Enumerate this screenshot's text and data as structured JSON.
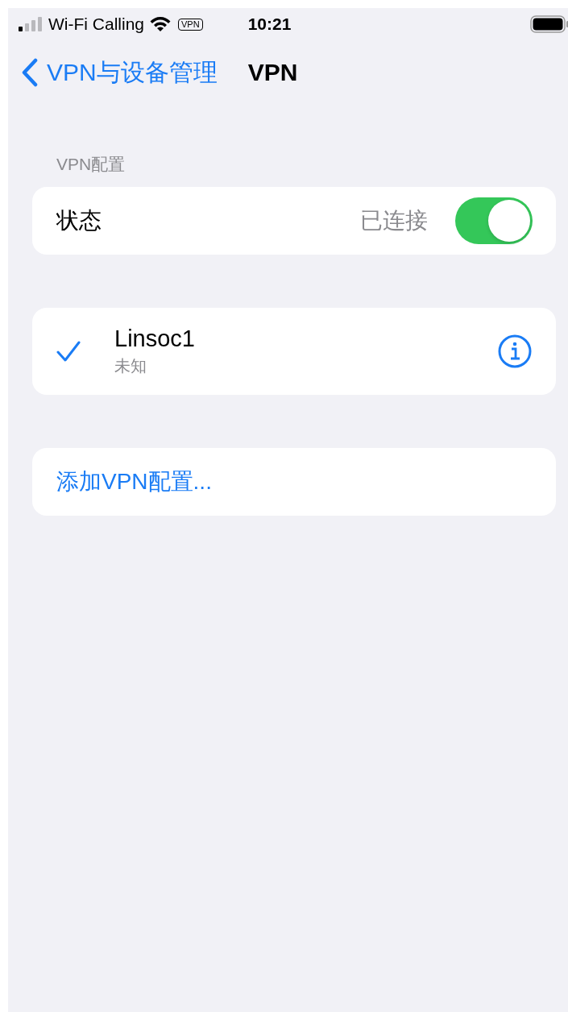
{
  "status_bar": {
    "carrier": "Wi-Fi Calling",
    "vpn_badge": "VPN",
    "time": "10:21"
  },
  "nav": {
    "back": "VPN与设备管理",
    "title": "VPN"
  },
  "section_header": "VPN配置",
  "status_row": {
    "label": "状态",
    "value": "已连接",
    "on": true
  },
  "profiles": [
    {
      "name": "Linsoc1",
      "status": "未知",
      "selected": true
    }
  ],
  "add_button": "添加VPN配置..."
}
